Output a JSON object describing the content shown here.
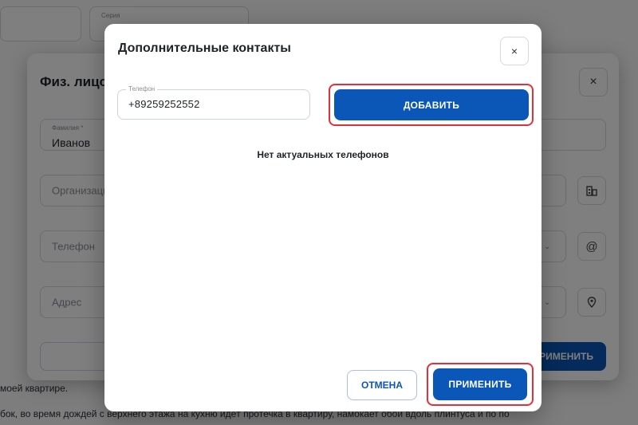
{
  "background": {
    "top_field_label": "Серия",
    "bottom_text_line1": "моей квартире.",
    "bottom_text_line2": "бок, во время дождей с верхнего этажа на кухню идёт протечка в квартиру, намокает обои вдоль плинтуса и по по"
  },
  "person_modal": {
    "title": "Физ. лицо",
    "close_label": "×",
    "surname": {
      "label": "Фамилия *",
      "value": "Иванов"
    },
    "organization": {
      "placeholder": "Организация"
    },
    "phone": {
      "placeholder": "Телефон"
    },
    "address": {
      "placeholder": "Адрес"
    },
    "apply_label": "ПРИМЕНИТЬ",
    "icons": [
      "building-icon",
      "at-icon",
      "location-pin-icon"
    ]
  },
  "dialog": {
    "title": "Дополнительные контакты",
    "close_label": "×",
    "phone_field": {
      "label": "Телефон",
      "value": "+89259252552"
    },
    "add_button": "ДОБАВИТЬ",
    "empty_message": "Нет актуальных телефонов",
    "cancel_button": "ОТМЕНА",
    "apply_button": "ПРИМЕНИТЬ"
  },
  "colors": {
    "primary": "#0b57b8",
    "highlight": "#e2303a"
  }
}
